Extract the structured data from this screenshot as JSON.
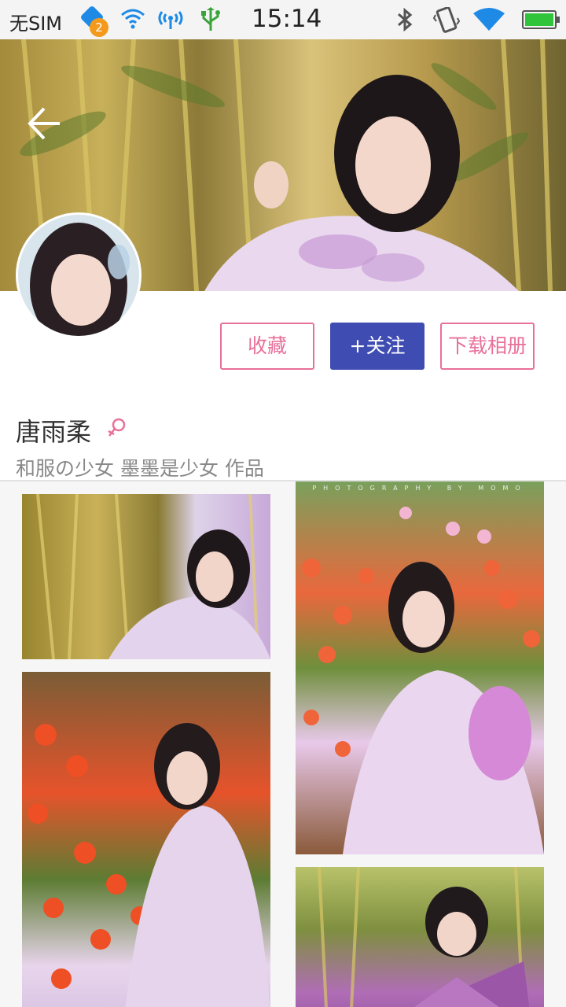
{
  "status_bar": {
    "carrier": "无SIM",
    "notification_count": "2",
    "time": "15:14",
    "icons": [
      "wifi-icon",
      "wifi-tether-icon",
      "usb-icon",
      "bluetooth-icon",
      "vibrate-icon",
      "wifi-signal-icon",
      "battery-icon"
    ],
    "battery_level": 1.0
  },
  "header": {
    "back_icon": "arrow-left-icon"
  },
  "actions": {
    "collect_label": "收藏",
    "follow_label": "+关注",
    "download_label": "下载相册"
  },
  "profile": {
    "name": "唐雨柔",
    "gender_icon": "female-icon",
    "subtitle": "和服の少女 墨墨是少女 作品"
  },
  "gallery": {
    "credit": "PHOTOGRAPHY BY MOMO"
  },
  "colors": {
    "accent_pink": "#e8709a",
    "follow_blue": "#3f4cb2",
    "battery_green": "#2fc43a"
  }
}
